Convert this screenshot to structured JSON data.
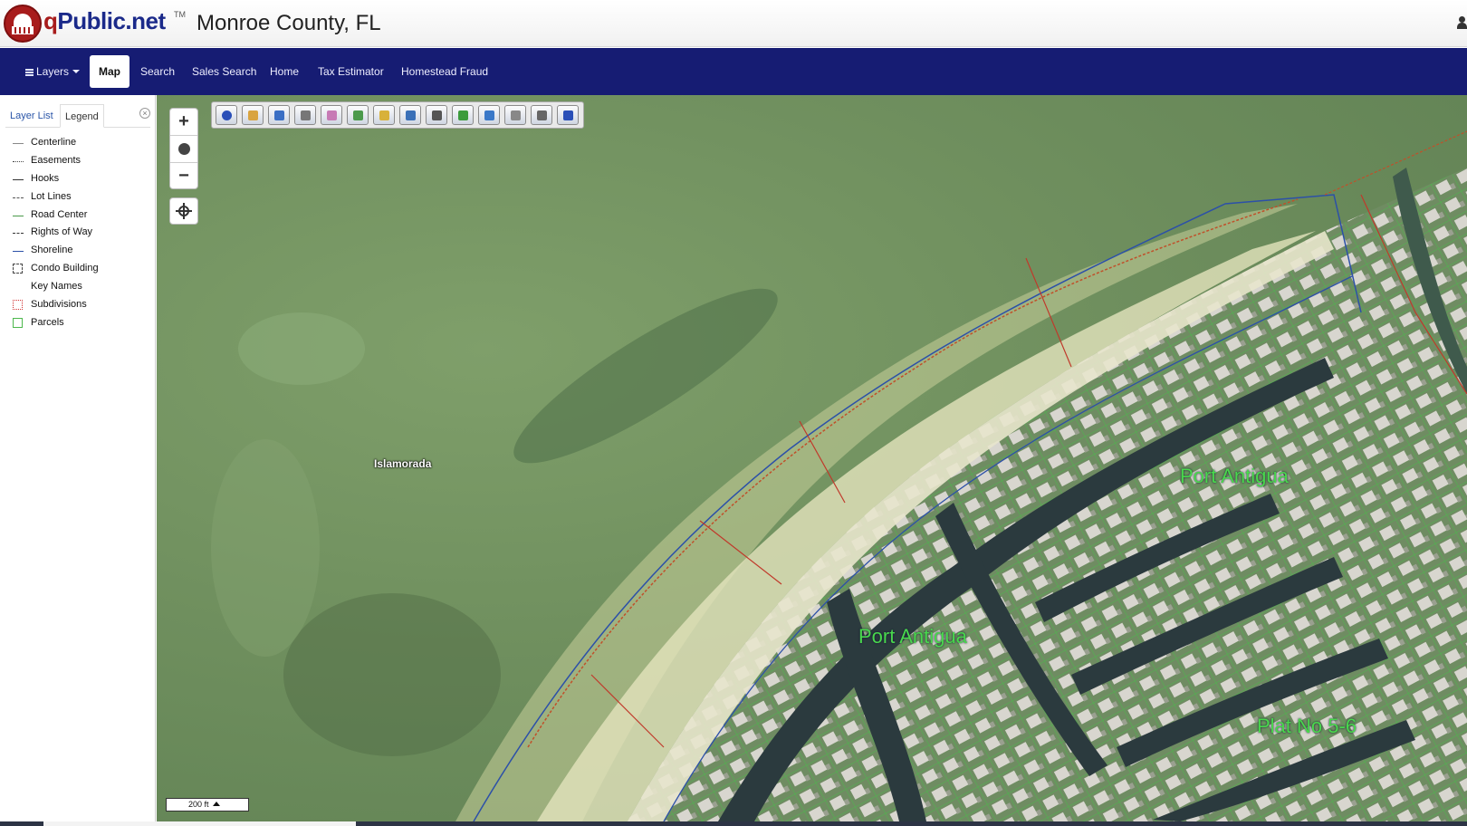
{
  "header": {
    "logo_q": "q",
    "logo_rest": "Public.net",
    "logo_tm": "TM",
    "county": "Monroe County, FL"
  },
  "nav": {
    "layers": "Layers",
    "map": "Map",
    "search": "Search",
    "sales_search": "Sales Search",
    "home": "Home",
    "tax_estimator": "Tax Estimator",
    "homestead_fraud": "Homestead Fraud"
  },
  "sidebar": {
    "tab_layer_list": "Layer List",
    "tab_legend": "Legend",
    "close_glyph": "×",
    "layers": [
      {
        "label": "Centerline",
        "symbol": "solid-grey"
      },
      {
        "label": "Easements",
        "symbol": "dotted"
      },
      {
        "label": "Hooks",
        "symbol": "solid-dark"
      },
      {
        "label": "Lot Lines",
        "symbol": "dashed"
      },
      {
        "label": "Road Center",
        "symbol": "green"
      },
      {
        "label": "Rights of Way",
        "symbol": "dash-dot"
      },
      {
        "label": "Shoreline",
        "symbol": "blue"
      },
      {
        "label": "Condo Building",
        "symbol": "box-dash"
      },
      {
        "label": "Key Names",
        "symbol": "none"
      },
      {
        "label": "Subdivisions",
        "symbol": "box-red"
      },
      {
        "label": "Parcels",
        "symbol": "box-green"
      }
    ]
  },
  "map": {
    "place_label": "Islamorada",
    "subdivision_labels": [
      "Port Antigua",
      "Port Antigua",
      "Plat No 5-6"
    ],
    "scale_label": "200 ft",
    "tool_icons": [
      "info-icon",
      "select-icon",
      "zoom-in-tool-icon",
      "pan-hand-icon",
      "eraser-icon",
      "select-parcels-icon",
      "marker-icon",
      "measure-icon",
      "magnify-icon",
      "draw-icon",
      "full-extent-icon",
      "settings-icon",
      "print-icon",
      "save-icon"
    ],
    "colors": {
      "navbar": "#161c73",
      "parcels": "#4db84d",
      "shoreline": "#2c50a8",
      "subdivisions": "#d03030",
      "canal": "#2b3a3e"
    }
  }
}
